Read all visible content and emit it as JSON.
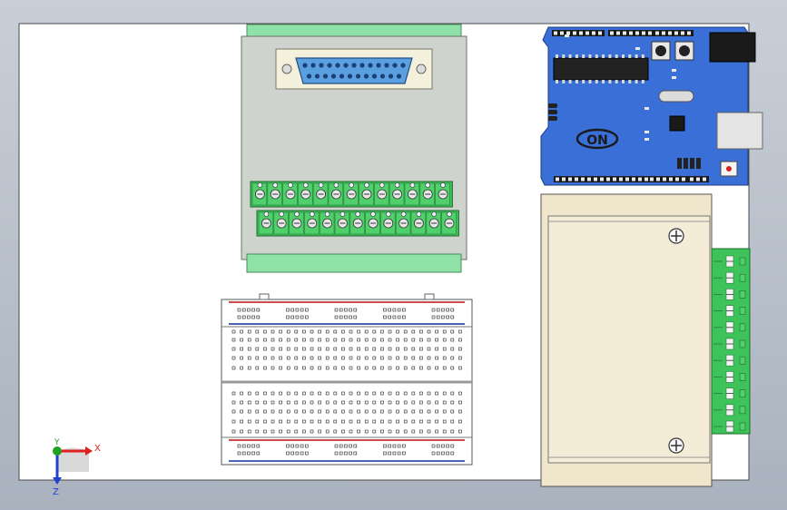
{
  "window": {
    "title": ""
  },
  "viewport": {
    "background_top": "#c9cfd8",
    "background_bottom": "#a9b2be",
    "sheet_color": "#ffffff",
    "sheet_border": "#4a4a4a"
  },
  "triad": {
    "x_label": "X",
    "y_label": "Y",
    "z_label": "Z",
    "x_color": "#e02020",
    "y_color": "#20a020",
    "z_color": "#2040d0"
  },
  "arduino": {
    "board_color": "#3a6fd8",
    "logo_text": "ON"
  },
  "terminal_board": {
    "body_color": "#cfd3cd",
    "rail_color": "#8ee2a8",
    "terminal_color": "#3ec25a"
  },
  "breadboard": {
    "body_color": "#ffffff",
    "red_rail": "#c01010",
    "blue_rail": "#1030a0"
  },
  "driver_box": {
    "body_color": "#efe6cc",
    "terminal_color": "#3ec25a"
  }
}
